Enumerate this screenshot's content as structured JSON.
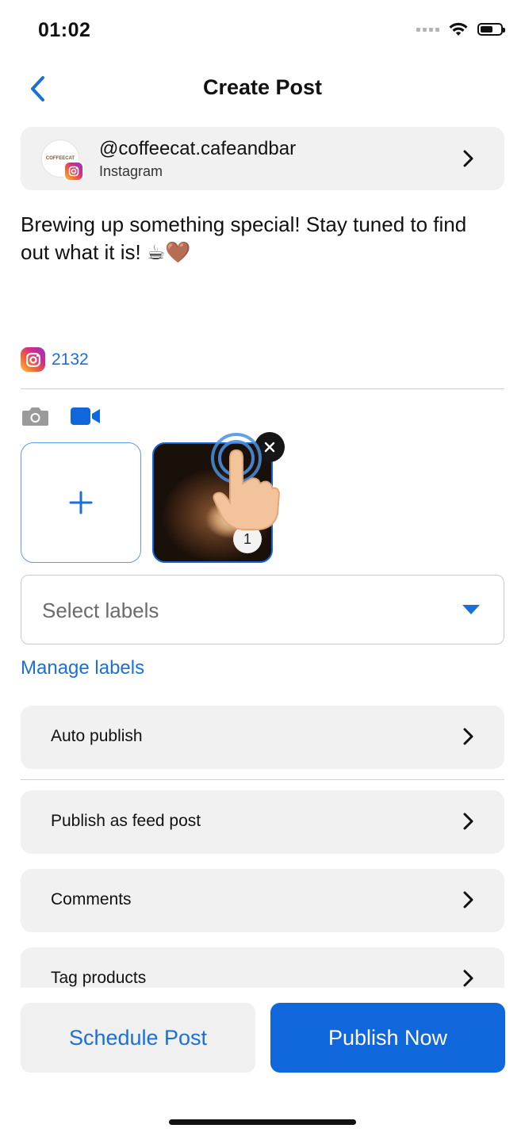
{
  "status_bar": {
    "time": "01:02"
  },
  "header": {
    "title": "Create Post"
  },
  "account": {
    "handle": "@coffeecat.cafeandbar",
    "network": "Instagram",
    "avatar_text": "COFFEECAT"
  },
  "post": {
    "text": "Brewing up something special! Stay tuned to find out what it is! ☕🤎",
    "character_count": "2132"
  },
  "media": {
    "selected_index": "1"
  },
  "labels": {
    "placeholder": "Select labels",
    "manage_link": "Manage labels"
  },
  "options": [
    {
      "label": "Auto publish"
    },
    {
      "label": "Publish as feed post"
    },
    {
      "label": "Comments"
    },
    {
      "label": "Tag products"
    }
  ],
  "actions": {
    "schedule": "Schedule Post",
    "publish": "Publish Now"
  },
  "colors": {
    "accent": "#1b6fd6",
    "primary_button": "#1067dc",
    "card_bg": "#f1f1f1"
  }
}
